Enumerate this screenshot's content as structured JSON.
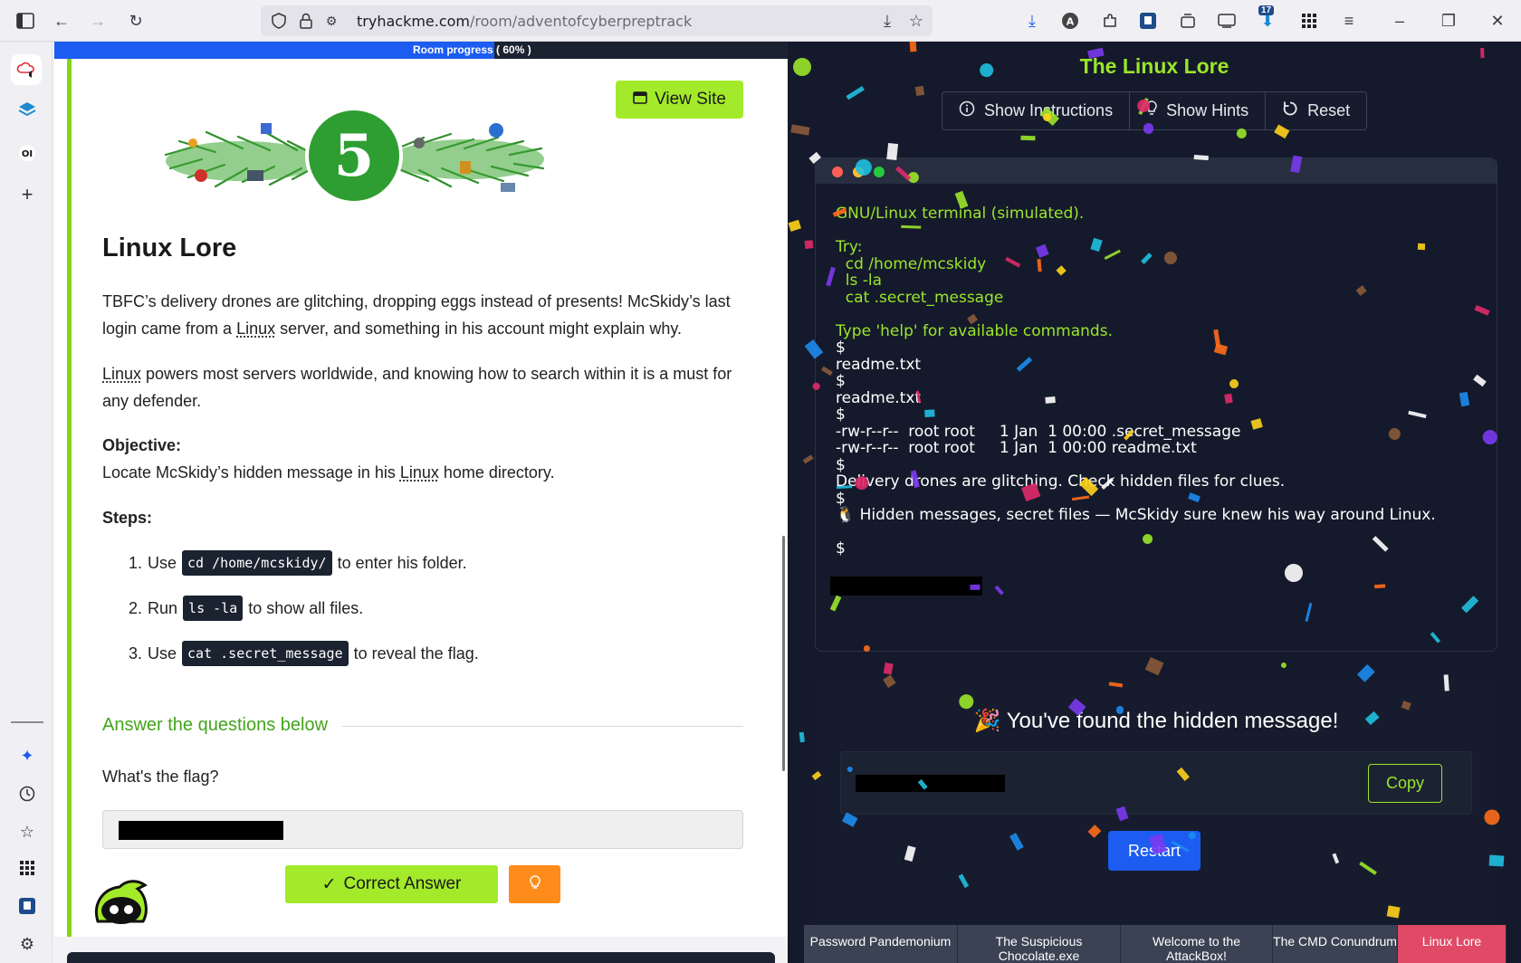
{
  "browser": {
    "url_domain": "tryhackme.com",
    "url_path": "/room/adventofcyberpreptrack",
    "notification_count": "17"
  },
  "room": {
    "progress_label": "Room progress ( 60% )",
    "progress_fraction": 0.6,
    "view_site_label": "View Site",
    "banner_number": "5",
    "title": "Linux Lore",
    "para1_a": "TBFC’s delivery drones are glitching, dropping eggs instead of presents! McSkidy’s last login came from a ",
    "para1_link": "Linux",
    "para1_b": " server, and something in his account might explain why.",
    "para2_link": "Linux",
    "para2_b": " powers most servers worldwide, and knowing how to search within it is a must for any defender.",
    "objective_label": "Objective:",
    "objective_a": "Locate McSkidy’s hidden message in his ",
    "objective_link": "Linux",
    "objective_b": " home directory.",
    "steps_label": "Steps:",
    "steps": [
      {
        "num": "1.",
        "pre": "Use",
        "code": "cd /home/mcskidy/",
        "post": "to enter his folder."
      },
      {
        "num": "2.",
        "pre": "Run",
        "code": "ls -la",
        "post": "to show all files."
      },
      {
        "num": "3.",
        "pre": "Use",
        "code": "cat .secret_message",
        "post": "to reveal the flag."
      }
    ],
    "answer_heading": "Answer the questions below",
    "question": "What's the flag?",
    "correct_label": "Correct Answer"
  },
  "lore": {
    "title": "The Linux Lore",
    "buttons": {
      "instructions": "Show Instructions",
      "hints": "Show Hints",
      "reset": "Reset"
    },
    "terminal_lines": [
      {
        "text": "GNU/Linux terminal (simulated).",
        "green": true
      },
      {
        "text": "",
        "green": false
      },
      {
        "text": "Try:",
        "green": true
      },
      {
        "text": "  cd /home/mcskidy",
        "green": true
      },
      {
        "text": "  ls -la",
        "green": true
      },
      {
        "text": "  cat .secret_message",
        "green": true
      },
      {
        "text": "",
        "green": false
      },
      {
        "text": "Type 'help' for available commands.",
        "green": true
      },
      {
        "text": "$",
        "green": false
      },
      {
        "text": "readme.txt",
        "green": false
      },
      {
        "text": "$",
        "green": false
      },
      {
        "text": "readme.txt",
        "green": false
      },
      {
        "text": "$",
        "green": false
      },
      {
        "text": "-rw-r--r--  root root     1 Jan  1 00:00 .secret_message",
        "green": false
      },
      {
        "text": "-rw-r--r--  root root     1 Jan  1 00:00 readme.txt",
        "green": false
      },
      {
        "text": "$",
        "green": false
      },
      {
        "text": "Delivery drones are glitching. Check hidden files for clues.",
        "green": false
      },
      {
        "text": "$",
        "green": false
      },
      {
        "text": "🐧 Hidden messages, secret files — McSkidy sure knew his way around Linux.",
        "green": false
      },
      {
        "text": "",
        "green": false
      },
      {
        "text": "$",
        "green": false
      }
    ],
    "found_title": "You've found the hidden message!",
    "copy_label": "Copy",
    "restart_label": "Restart",
    "tabs": [
      "Password Pandemonium",
      "The Suspicious Chocolate.exe",
      "Welcome to the AttackBox!",
      "The CMD Conundrum",
      "Linux Lore"
    ]
  },
  "colors": {
    "accent_green": "#a3ea2a",
    "brand_blue": "#1c5cf0",
    "hint_orange": "#ff8c1a",
    "dark_bg": "#141a2b"
  }
}
